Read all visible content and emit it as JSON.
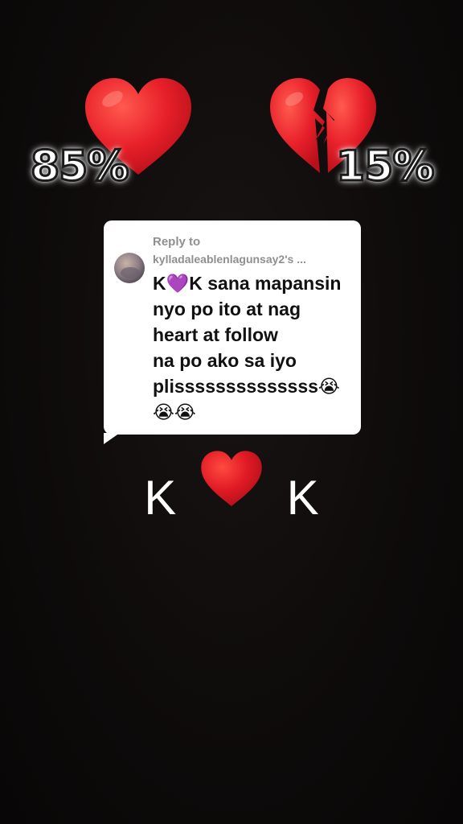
{
  "hearts": {
    "left": {
      "icon": "red-heart-icon",
      "percent": "85%"
    },
    "right": {
      "icon": "broken-heart-icon",
      "percent": "15%"
    }
  },
  "reply": {
    "label": "Reply to",
    "username": "kylladaleablenlagunsay2's ...",
    "lines": [
      "K💜K sana mapansin",
      "nyo po ito at nag",
      "heart at follow",
      "na po ako sa iyo",
      "plissssssssssssss😭",
      "😭😭"
    ]
  },
  "caption": {
    "left_letter": "K",
    "right_letter": "K",
    "heart_icon": "red-heart-icon"
  },
  "colors": {
    "background": "#0d0a0a",
    "heart_red": "#e8202a",
    "card": "#ffffff"
  }
}
